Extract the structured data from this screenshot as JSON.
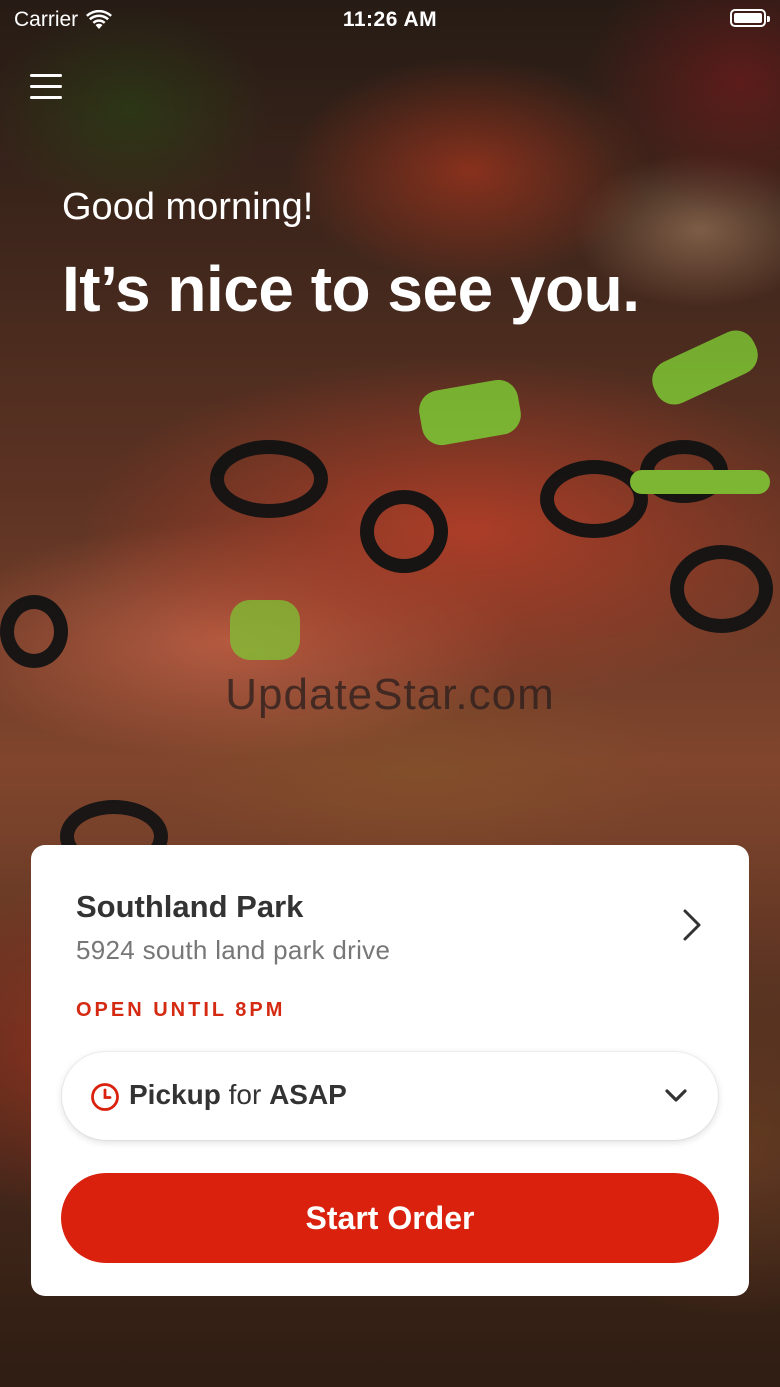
{
  "status_bar": {
    "carrier": "Carrier",
    "time": "11:26 AM"
  },
  "hero": {
    "greeting": "Good morning!",
    "headline": "It’s nice to see you.",
    "watermark": "UpdateStar.com"
  },
  "store": {
    "name": "Southland Park",
    "address": "5924 south land park drive",
    "hours": "OPEN UNTIL 8PM"
  },
  "order_mode": {
    "mode": "Pickup",
    "connector": "for",
    "time": "ASAP"
  },
  "actions": {
    "start_order": "Start Order"
  },
  "icons": {
    "menu": "hamburger-menu-icon",
    "wifi": "wifi-icon",
    "battery": "battery-icon",
    "store_chevron": "chevron-right-icon",
    "clock": "clock-icon",
    "dropdown": "chevron-down-icon"
  },
  "colors": {
    "brand_red": "#d9210e",
    "hours_red": "#d42a12"
  }
}
